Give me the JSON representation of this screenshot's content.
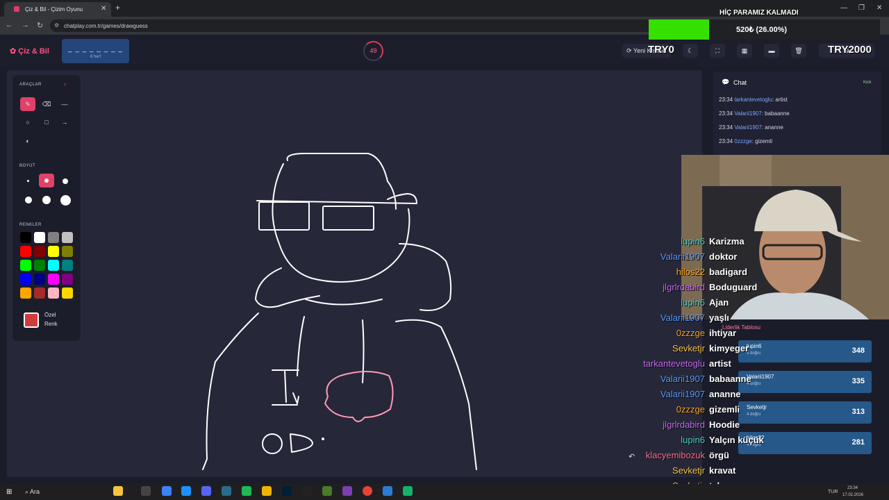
{
  "browser": {
    "tab_title": "Çiz & Bil - Çizim Oyunu",
    "url": "chatplay.com.tr/games/drawguess",
    "new_tab_label": "+",
    "close_label": "✕"
  },
  "overlay": {
    "title": "HİÇ PARAMIZ KALMADI",
    "progress_text": "520₺ (26.00%)",
    "progress_fraction": 0.26,
    "left_label": "TRY0",
    "right_label": "TRY2000"
  },
  "header": {
    "logo": "Çiz & Bil",
    "word_mask": "_ _ _ _ _ _ _ _",
    "word_hint": "8 harf",
    "timer": "49",
    "new_word_label": "Yeni Kelime"
  },
  "tools": {
    "tools_label": "ARAÇLAR",
    "size_label": "BOYUT",
    "colors_label": "RENKLER",
    "custom_color_label_1": "Özel",
    "custom_color_label_2": "Renk",
    "custom_color": "#d03c3c",
    "palette": [
      "#000000",
      "#ffffff",
      "#808080",
      "#c0c0c0",
      "#ff0000",
      "#800000",
      "#ffff00",
      "#808000",
      "#00ff00",
      "#008000",
      "#00ffff",
      "#008080",
      "#0000ff",
      "#000080",
      "#ff00ff",
      "#800080",
      "#ffa500",
      "#a52a2a",
      "#ffb6c1",
      "#ffd700"
    ]
  },
  "chat": {
    "title": "Chat",
    "kick_label": "Kick",
    "messages": [
      {
        "time": "23:34",
        "user": "tarkantevetoglu",
        "text": ": artist"
      },
      {
        "time": "23:34",
        "user": "Valarii1907",
        "text": ": babaanne"
      },
      {
        "time": "23:34",
        "user": "Valarii1907",
        "text": ": ananne"
      },
      {
        "time": "23:34",
        "user": "0zzzge",
        "text": ": gizemli"
      }
    ]
  },
  "leaderboard": {
    "title": "Liderlik Tablosu",
    "rows": [
      {
        "name": "lupin6",
        "sub": "5 doğru",
        "points": "348"
      },
      {
        "name": "Valarii1907",
        "sub": "4 doğru",
        "points": "335"
      },
      {
        "name": "Sevketjr",
        "sub": "4 doğru",
        "points": "313"
      },
      {
        "name": "hilos22",
        "sub": "4 doğru",
        "points": "281"
      }
    ]
  },
  "overlay_chat": [
    {
      "user": "lupin6",
      "text": "Karizma",
      "color": "#4fd1c5"
    },
    {
      "user": "Valarii1907",
      "text": "doktor",
      "color": "#5b9bff"
    },
    {
      "user": "hilos22",
      "text": "badigard",
      "color": "#f5a623"
    },
    {
      "user": "jlgrlrdabird",
      "text": "Boduguard",
      "color": "#c56cf0"
    },
    {
      "user": "lupin6",
      "text": "Ajan",
      "color": "#4fd1c5"
    },
    {
      "user": "Valarii1907",
      "text": "yaşlı",
      "color": "#5b9bff"
    },
    {
      "user": "0zzzge",
      "text": "ihtiyar",
      "color": "#f5a623"
    },
    {
      "user": "Sevketjr",
      "text": "kimyeger",
      "color": "#f5c542"
    },
    {
      "user": "tarkantevetoglu",
      "text": "artist",
      "color": "#c56cf0"
    },
    {
      "user": "Valarii1907",
      "text": "babaanne",
      "color": "#5b9bff"
    },
    {
      "user": "Valarii1907",
      "text": "ananne",
      "color": "#5b9bff"
    },
    {
      "user": "0zzzge",
      "text": "gizemli",
      "color": "#f5a623"
    },
    {
      "user": "jlgrlrdabird",
      "text": "Hoodie",
      "color": "#c56cf0"
    },
    {
      "user": "lupin6",
      "text": "Yalçın küçük",
      "color": "#4fd1c5"
    },
    {
      "user": "klacyemibozuk",
      "text": "örgü",
      "color": "#ff6f91"
    },
    {
      "user": "Sevketjr",
      "text": "kravat",
      "color": "#f5c542"
    },
    {
      "user": "Sevketjr",
      "text": "takım",
      "color": "#f5c542"
    }
  ],
  "taskbar": {
    "search_label": "Ara",
    "lang": "TUR",
    "time": "23:34",
    "date": "17.02.2026"
  }
}
